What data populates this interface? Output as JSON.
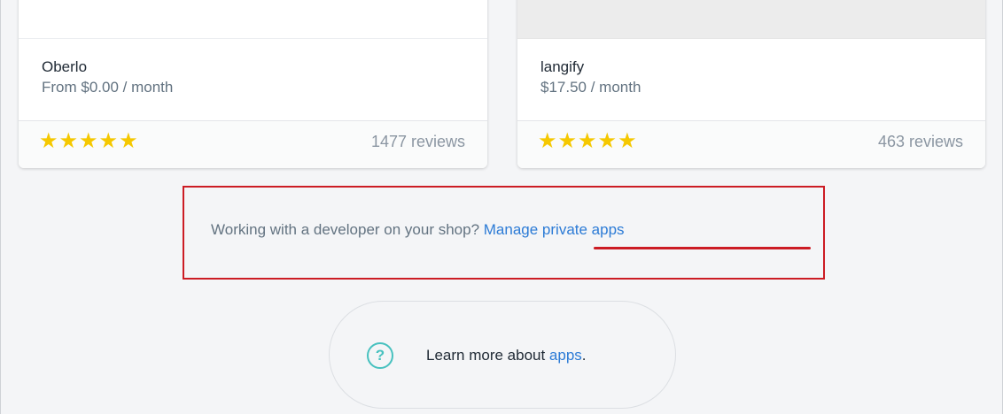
{
  "apps": [
    {
      "name": "Oberlo",
      "price": "From $0.00 / month",
      "rating": 5,
      "reviews": "1477 reviews"
    },
    {
      "name": "langify",
      "price": "$17.50 / month",
      "rating": 5,
      "reviews": "463 reviews"
    }
  ],
  "developer": {
    "prompt": "Working with a developer on your shop? ",
    "link": "Manage private apps"
  },
  "learn_more": {
    "icon": "question-circle-icon",
    "text": "Learn more about ",
    "link": "apps",
    "suffix": "."
  },
  "colors": {
    "star": "#f5c800",
    "link": "#2c7bd6",
    "highlight": "#cc1c24",
    "help_icon": "#47c1bf"
  }
}
